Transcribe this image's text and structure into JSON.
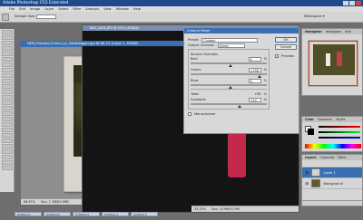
{
  "app": {
    "title": "Adobe Photoshop CS3 Extended"
  },
  "menu": [
    "File",
    "Edit",
    "Image",
    "Layer",
    "Select",
    "Filter",
    "Analysis",
    "View",
    "Window",
    "Help"
  ],
  "options": {
    "preset_label": "Sample Size:",
    "workspace_label": "Workspace ▾"
  },
  "docs": {
    "main_title": "NEW_Polaroid_Frame_by_Solidblogger.jpg @ 66.7% (Layer 1, RGB/8)",
    "second_title": "IMG_1001.JPG @ 25% (RGB/8)",
    "main_zoom": "66.67%",
    "main_doc_info": "Doc: 1.76M/5.98M",
    "second_zoom": "33.33%",
    "second_doc_info": "Doc: 10.9M/10.9M"
  },
  "dialog": {
    "title": "Channel Mixer",
    "preset_label": "Preset:",
    "preset_value": "Custom",
    "output_label": "Output Channel:",
    "output_value": "Green",
    "source_label": "Source Channels",
    "channels": [
      {
        "label": "Red:",
        "value": "0",
        "unit": "%",
        "pos": 0.5
      },
      {
        "label": "Green:",
        "value": "+156",
        "unit": "%",
        "pos": 0.89
      },
      {
        "label": "Blue:",
        "value": "0",
        "unit": "%",
        "pos": 0.5
      }
    ],
    "total_label": "Total:",
    "total_value": "+65",
    "total_unit": "%",
    "constant_label": "Constant:",
    "constant_value": "+24",
    "constant_unit": "%",
    "constant_pos": 0.62,
    "monochrome_label": "Monochrome",
    "ok_label": "OK",
    "cancel_label": "Cancel",
    "preview_label": "Preview"
  },
  "panels": {
    "nav_tabs": [
      "Navigator",
      "Histogram",
      "Info"
    ],
    "color_tabs": [
      "Color",
      "Swatches",
      "Styles"
    ],
    "layers_tabs": [
      "Layers",
      "Channels",
      "Paths"
    ],
    "layers": [
      {
        "name": "Layer 1",
        "selected": true
      },
      {
        "name": "Background",
        "selected": false
      }
    ]
  },
  "taskbar": [
    "Untitled-1",
    "Untitled-2",
    "Untitled-3",
    "Untitled-4",
    "Untitled-5"
  ],
  "colors": {
    "accent": "#3a6fb3",
    "titlebar": "#1e4a8c",
    "photo_frame": "#d9d5cc",
    "photo_tint": "#6b6a2e"
  }
}
